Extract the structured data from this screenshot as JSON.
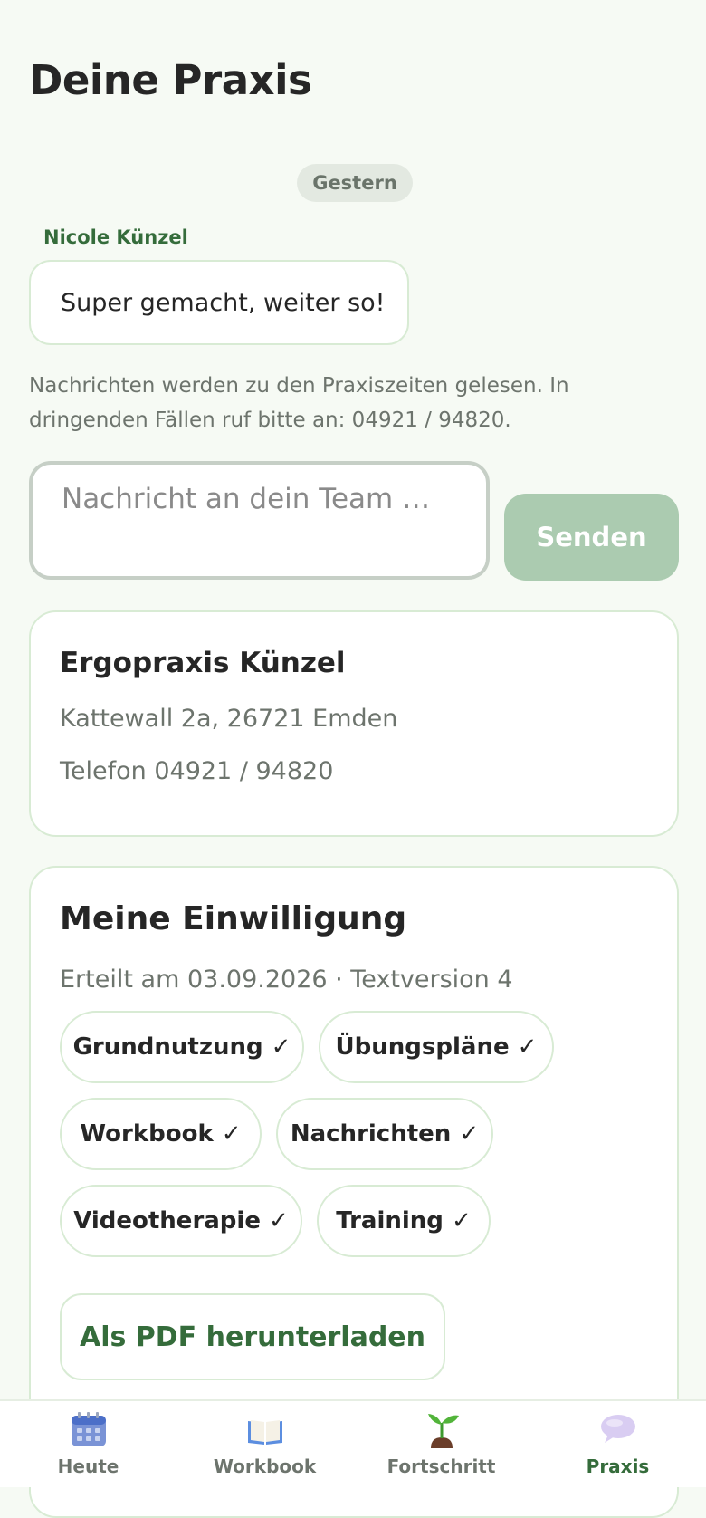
{
  "page": {
    "title": "Deine Praxis"
  },
  "chat": {
    "date_separator": "Gestern",
    "message": {
      "sender": "Nicole Künzel",
      "text": "Super gemacht, weiter so!"
    },
    "hint": "Nachrichten werden zu den Praxiszeiten gelesen. In dringenden Fällen ruf bitte an: 04921 / 94820.",
    "input_placeholder": "Nachricht an dein Team …",
    "send_label": "Senden",
    "send_color": "#abcbb0"
  },
  "practice": {
    "name": "Ergopraxis Künzel",
    "address": "Kattewall 2a, 26721 Emden",
    "phone": "Telefon 04921 / 94820"
  },
  "consent": {
    "title": "Meine Einwilligung",
    "meta": "Erteilt am 03.09.2026 · Textversion 4",
    "chips": [
      "Grundnutzung ✓",
      "Übungspläne ✓",
      "Workbook ✓",
      "Nachrichten ✓",
      "Videotherapie ✓",
      "Training ✓"
    ],
    "pdf_label": "Als PDF herunterladen"
  },
  "nav": {
    "items": [
      {
        "label": "Heute",
        "icon": "calendar-icon"
      },
      {
        "label": "Workbook",
        "icon": "book-icon"
      },
      {
        "label": "Fortschritt",
        "icon": "seedling-icon"
      },
      {
        "label": "Praxis",
        "icon": "speech-bubble-icon"
      }
    ],
    "active": "Praxis",
    "active_color": "#356c3b"
  },
  "colors": {
    "accent": "#356c3b",
    "background": "#f6faf4",
    "border": "#d8ebd4"
  }
}
